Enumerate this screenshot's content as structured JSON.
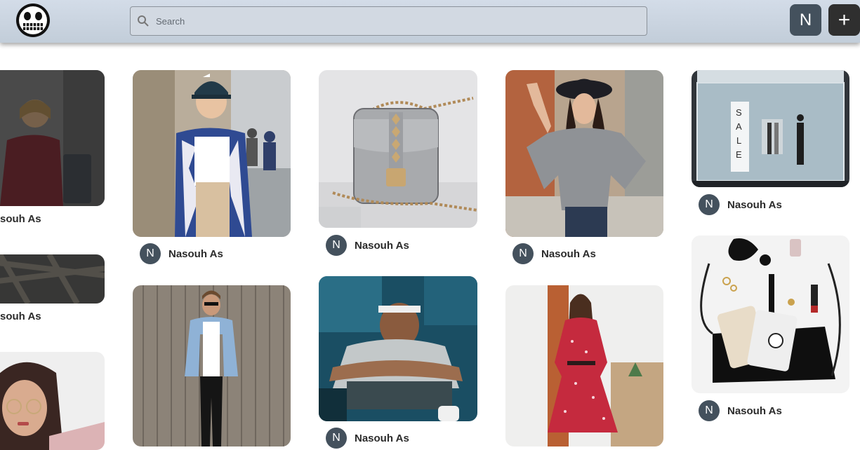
{
  "header": {
    "search_placeholder": "Search",
    "avatar_initial": "N",
    "add_label": "+"
  },
  "pins": {
    "author_initial": "N",
    "author_name": "Nasouh As",
    "author_name_cropped": "souh As"
  },
  "colors": {
    "header_bg": "#c9d3df",
    "avatar_bg": "#44515d",
    "add_bg": "#2f2f2f"
  }
}
